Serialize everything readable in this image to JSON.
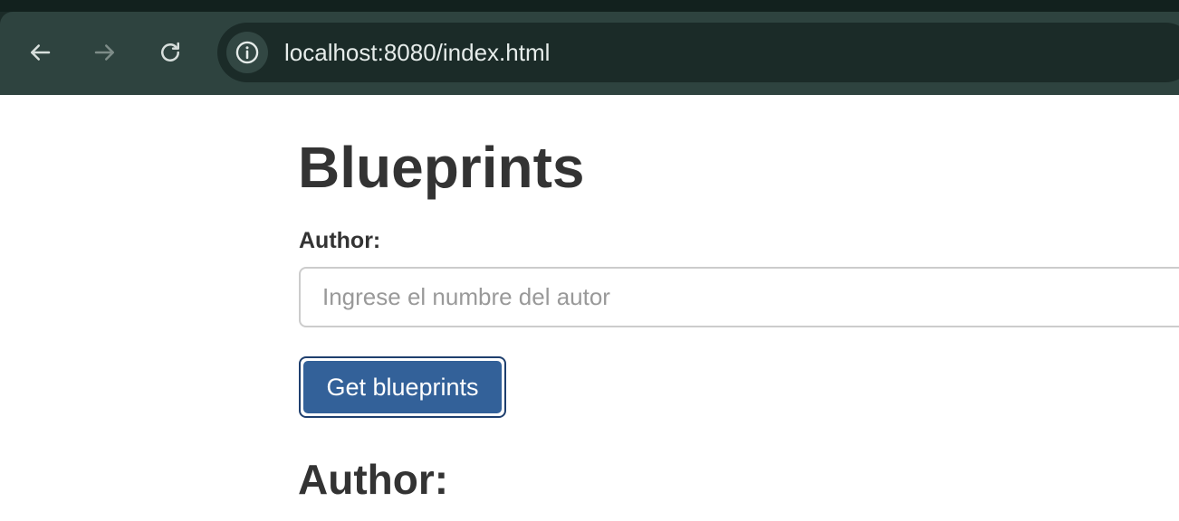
{
  "browser": {
    "url": "localhost:8080/index.html",
    "icons": {
      "back": "arrow-left-icon",
      "forward": "arrow-right-icon",
      "reload": "reload-icon",
      "site_info": "info-icon"
    }
  },
  "page": {
    "title": "Blueprints",
    "author_label": "Author:",
    "author_input": {
      "value": "",
      "placeholder": "Ingrese el numbre del autor"
    },
    "get_button_label": "Get blueprints",
    "author_heading": "Author:"
  },
  "colors": {
    "chrome_background": "#2e433f",
    "omnibox_background": "#1b2b28",
    "button_primary": "#336199",
    "text_dark": "#333333"
  }
}
